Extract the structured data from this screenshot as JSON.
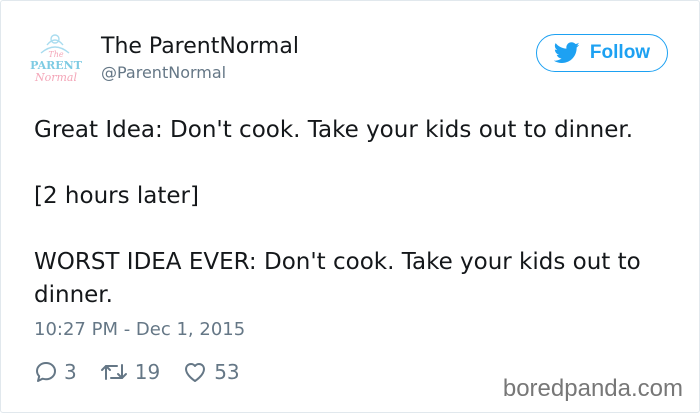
{
  "tweet": {
    "author": {
      "display_name": "The ParentNormal",
      "handle": "@ParentNormal",
      "avatar_text": {
        "line1": "The",
        "line2": "PARENT",
        "line3": "Normal"
      }
    },
    "follow_label": "Follow",
    "text": {
      "line1": "Great Idea: Don't cook. Take your kids out to dinner.",
      "line2": "[2 hours later]",
      "line3": "WORST IDEA EVER: Don't cook. Take your kids out to dinner."
    },
    "timestamp": "10:27 PM - Dec 1, 2015",
    "stats": {
      "replies": "3",
      "retweets": "19",
      "likes": "53"
    }
  },
  "watermark": "boredpanda.com",
  "colors": {
    "twitter_blue": "#1da1f2",
    "secondary_text": "#657786",
    "primary_text": "#14171a",
    "border": "#e1e8ed"
  },
  "icons": {
    "follow": "twitter-bird-icon",
    "reply": "reply-bubble-icon",
    "retweet": "retweet-icon",
    "like": "heart-icon"
  }
}
